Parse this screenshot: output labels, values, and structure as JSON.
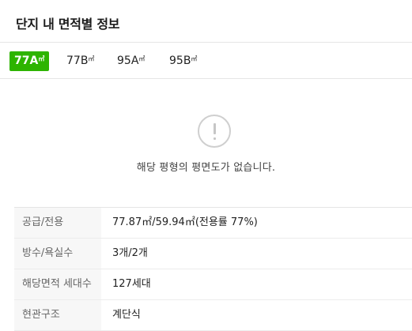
{
  "header": {
    "title": "단지 내 면적별 정보"
  },
  "tabs": [
    {
      "label": "77A",
      "unit": "㎡",
      "active": true
    },
    {
      "label": "77B",
      "unit": "㎡",
      "active": false
    },
    {
      "label": "95A",
      "unit": "㎡",
      "active": false
    },
    {
      "label": "95B",
      "unit": "㎡",
      "active": false
    }
  ],
  "empty": {
    "message": "해당 평형의 평면도가 없습니다.",
    "icon": "exclamation-circle-icon"
  },
  "info": [
    {
      "label": "공급/전용",
      "value": "77.87㎡/59.94㎡(전용률 77%)"
    },
    {
      "label": "방수/욕실수",
      "value": "3개/2개"
    },
    {
      "label": "해당면적 세대수",
      "value": "127세대"
    },
    {
      "label": "현관구조",
      "value": "계단식"
    }
  ],
  "colors": {
    "accent": "#2db400",
    "border": "#e5e5e5",
    "label_bg": "#f7f7f7"
  }
}
